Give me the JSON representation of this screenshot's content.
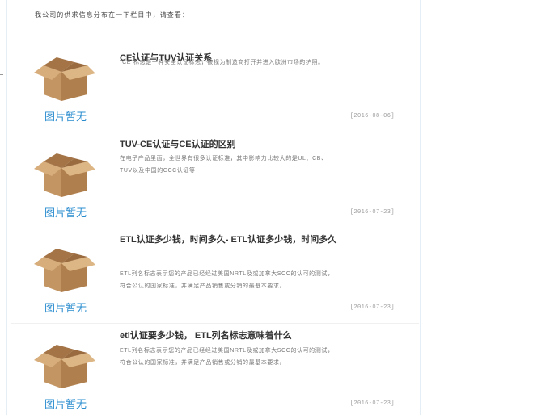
{
  "intro": "我公司的供求信息分布在一下栏目中，请查看：",
  "no_image_label": "图片暂无",
  "articles": [
    {
      "title": "CE认证与TUV认证关系",
      "summary": "\"CE\"标志是一种安全认证标志，被视为制造商打开并进入欧洲市场的护照。",
      "date": "[2016-08-06]"
    },
    {
      "title": "TUV-CE认证与CE认证的区别",
      "summary": "在电子产品里面，全世界有很多认证标准，其中影响力比较大的是UL、CB、TUV以及中国的CCC认证等",
      "date": "[2016-07-23]"
    },
    {
      "title": "ETL认证多少钱，时间多久- ETL认证多少钱，时间多久",
      "summary": "ETL列名标志表示您的产品已经经过美国NRTL及或加拿大SCC的认可的测试，符合公认的国家标准，并满足产品销售或分销的最基本要求。",
      "date": "[2016-07-23]"
    },
    {
      "title": "etl认证要多少钱， ETL列名标志意味着什么",
      "summary": "ETL列名标志表示您的产品已经经过美国NRTL及或加拿大SCC的认可的测试，符合公认的国家标准，并满足产品销售或分销的最基本要求。",
      "date": "[2016-07-23]"
    }
  ]
}
